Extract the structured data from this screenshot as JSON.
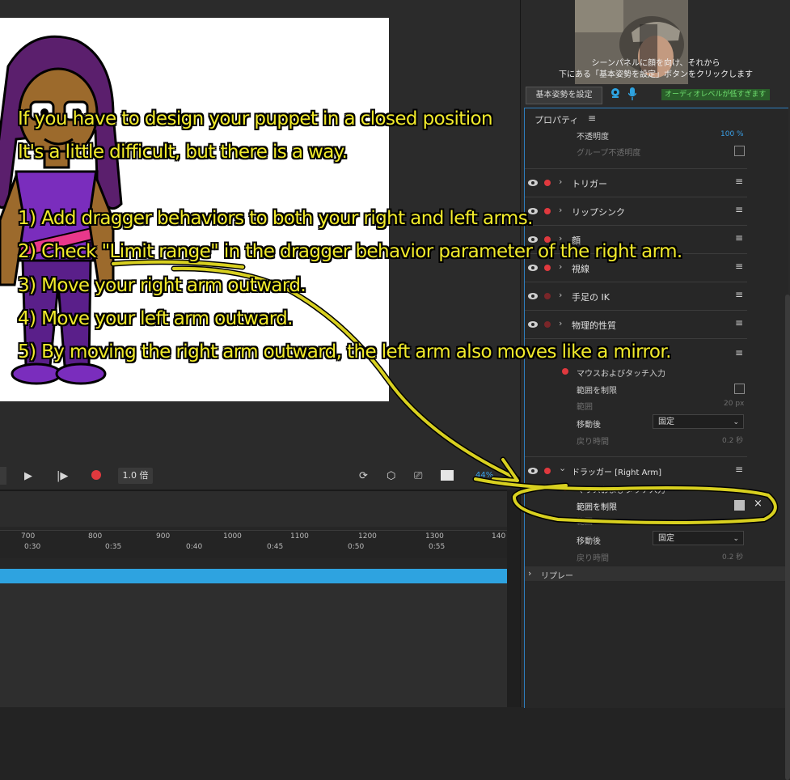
{
  "transport": {
    "speed": "1.0 倍",
    "zoom": "44%"
  },
  "timeline": {
    "ruler_frames": [
      "700",
      "800",
      "900",
      "1000",
      "1100",
      "1200",
      "1300",
      "140"
    ],
    "ruler_times": [
      "0:30",
      "0:35",
      "0:40",
      "0:45",
      "0:50",
      "0:55"
    ]
  },
  "camera": {
    "message_line1": "シーンパネルに顔を向け、それから",
    "message_line2": "下にある「基本姿勢を設定」ボタンをクリックします",
    "set_pose_button": "基本姿勢を設定",
    "audio_level": "オーディオレベルが低すぎます"
  },
  "properties": {
    "header": "プロパティ",
    "opacity_label": "不透明度",
    "opacity_value": "100 %",
    "group_opacity_label": "グループ不透明度",
    "behaviors": [
      {
        "name": "トリガー"
      },
      {
        "name": "リップシンク"
      },
      {
        "name": "顔"
      },
      {
        "name": "視線"
      },
      {
        "name": "手足の IK"
      },
      {
        "name": "物理的性質"
      }
    ],
    "left_dragger": {
      "mouse_touch": "マウスおよびタッチ入力",
      "limit_range": "範囲を制限",
      "range_label": "範囲",
      "range_value": "20 px",
      "after_move_label": "移動後",
      "after_move_value": "固定",
      "return_time_label": "戻り時間",
      "return_time_value": "0.2 秒"
    },
    "right_dragger": {
      "name": "ドラッガー [Right Arm]",
      "mouse_touch": "マウスおよびタッチ入力",
      "limit_range": "範囲を制限",
      "range_label": "範囲",
      "after_move_label": "移動後",
      "after_move_value": "固定",
      "return_time_label": "戻り時間",
      "return_time_value": "0.2 秒"
    },
    "replay": "リプレー"
  },
  "annotation": {
    "line1": "If you have to design your puppet in a closed position",
    "line2": "It's a little difficult, but there is a way.",
    "step1": "1) Add dragger behaviors to both your right and left arms.",
    "step2": "2) Check \"Limit range\" in the dragger behavior parameter of the right arm.",
    "step3": "3) Move your right arm outward.",
    "step4": "4) Move your left arm outward.",
    "step5": "5) By moving the right arm outward, the left arm also moves like a mirror."
  },
  "colors": {
    "accent_blue": "#2ea3e0",
    "record_red": "#e0393e",
    "annotation_yellow": "#f1ea2b"
  }
}
